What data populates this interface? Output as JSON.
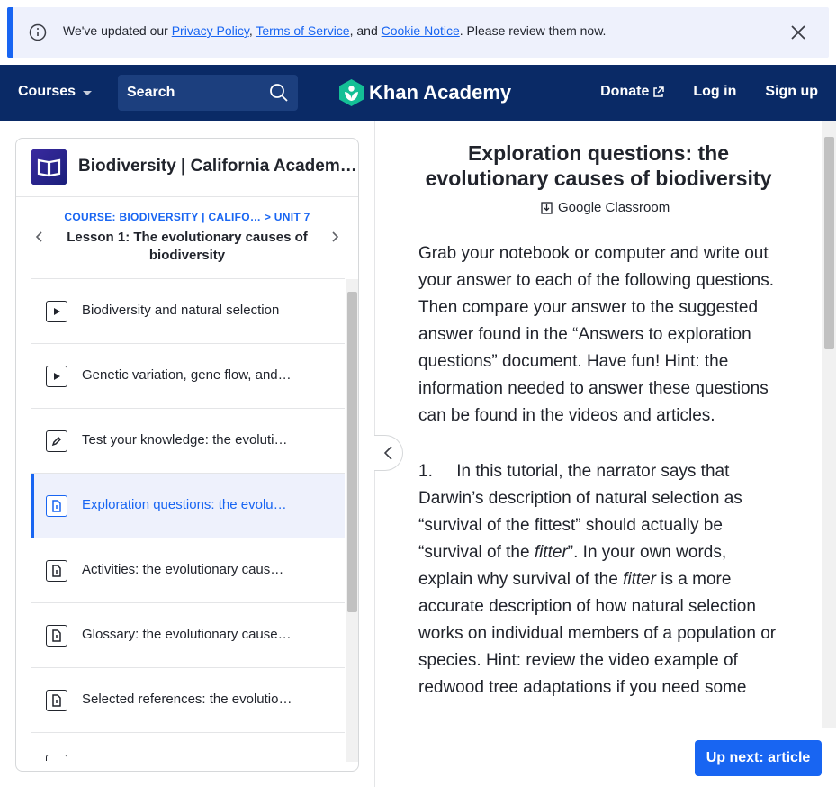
{
  "banner": {
    "prefix": "We've updated our ",
    "privacy": "Privacy Policy",
    "sep1": ", ",
    "terms": "Terms of Service",
    "sep2": ", and ",
    "cookie": "Cookie Notice",
    "suffix": ". Please review them now."
  },
  "nav": {
    "courses": "Courses",
    "search": "Search",
    "logo": "Khan Academy",
    "donate": "Donate",
    "login": "Log in",
    "signup": "Sign up"
  },
  "sidebar": {
    "course_title": "Biodiversity | California Academy…",
    "breadcrumb_course": "COURSE: BIODIVERSITY | CALIFO…",
    "breadcrumb_sep": " > ",
    "breadcrumb_unit": "UNIT 7",
    "lesson": "Lesson 1: The evolutionary causes of biodiversity",
    "items": [
      {
        "label": "Biodiversity and natural selection",
        "icon": "play-icon"
      },
      {
        "label": "Genetic variation, gene flow, and…",
        "icon": "play-icon"
      },
      {
        "label": "Test your knowledge: the evoluti…",
        "icon": "pencil-icon"
      },
      {
        "label": "Exploration questions: the evolu…",
        "icon": "article-icon",
        "active": true
      },
      {
        "label": "Activities: the evolutionary caus…",
        "icon": "article-icon"
      },
      {
        "label": "Glossary: the evolutionary cause…",
        "icon": "article-icon"
      },
      {
        "label": "Selected references: the evolutio…",
        "icon": "article-icon"
      }
    ]
  },
  "content": {
    "title": "Exploration questions: the evolutionary causes of biodiversity",
    "classroom": "Google Classroom",
    "intro": "Grab your notebook or computer and write out your answer to each of the following questions. Then compare your answer to the suggested answer found in the “Answers to exploration questions” document. Have fun! Hint: the information needed to answer these questions can be found in the videos and articles.",
    "q1_num": "1.",
    "q1_a": "In this tutorial, the narrator says that Darwin’s description of natural selection as “survival of the fittest” should actually be “survival of the ",
    "q1_em1": "fitter",
    "q1_b": "”. In your own words, explain why survival of the ",
    "q1_em2": "fitter",
    "q1_c": " is a more accurate description of how natural selection works on individual members of a population or species. Hint: review the video example of redwood tree adaptations if you need some",
    "upnext": "Up next: article"
  },
  "colors": {
    "nav_bg": "#0a2a66",
    "accent": "#1865f2",
    "logo_green": "#14bf96"
  }
}
